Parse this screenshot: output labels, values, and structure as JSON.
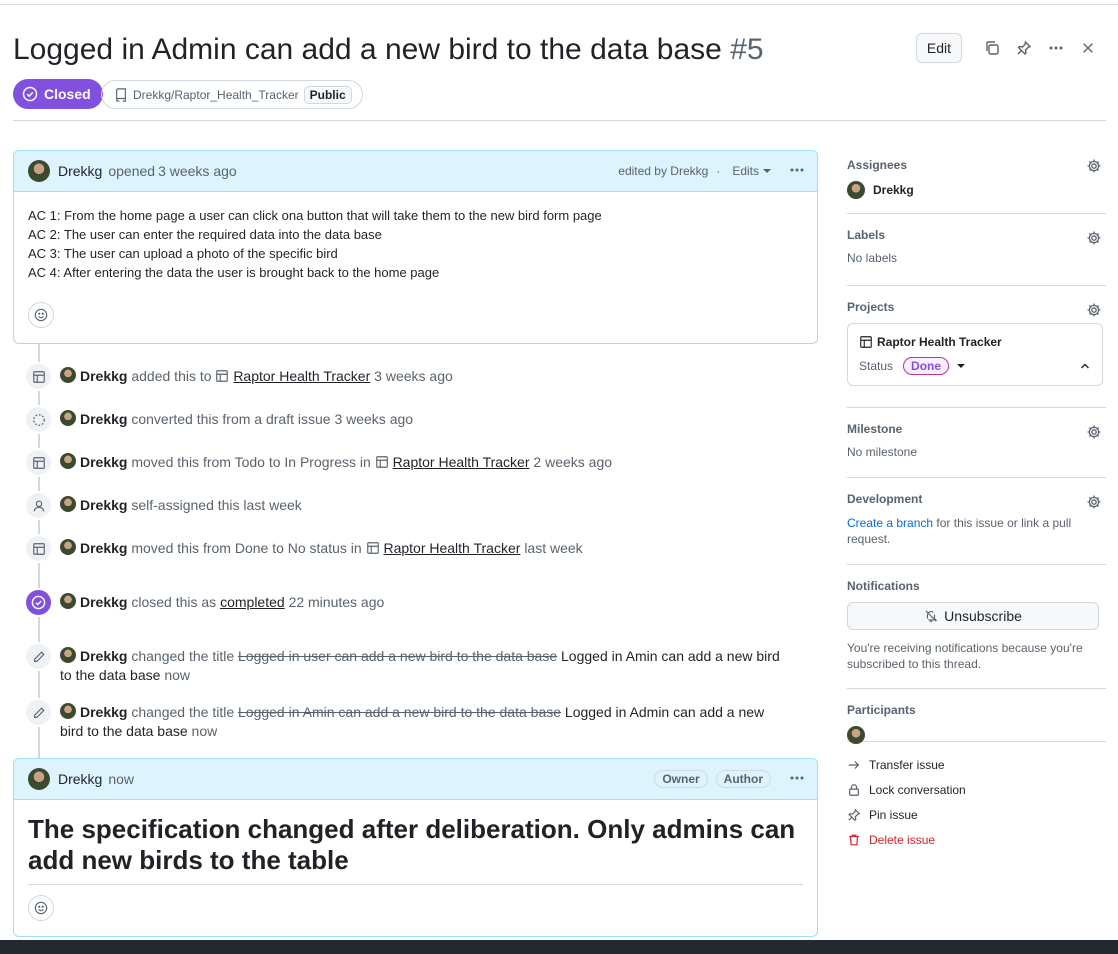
{
  "issue": {
    "title": "Logged in Admin can add a new bird to the data base",
    "number": "#5",
    "state": "Closed",
    "repo": "Drekkg/Raptor_Health_Tracker",
    "visibility": "Public",
    "edit_label": "Edit"
  },
  "opening_comment": {
    "author": "Drekkg",
    "action": "opened",
    "time": "3 weeks ago",
    "edited_by": "edited by Drekkg",
    "separator": "·",
    "edits_label": "Edits",
    "lines": [
      "AC 1: From the home page a user can click ona button that will take them to the new bird form page",
      "AC 2: The user can enter the required data into the data base",
      "AC 3: The user can upload a photo of the specific bird",
      "AC 4: After entering the data the user is brought back to the home page"
    ]
  },
  "timeline": [
    {
      "actor": "Drekkg",
      "text": "added this to",
      "link": "Raptor Health Tracker",
      "time": "3 weeks ago",
      "icon": "table-icon"
    },
    {
      "actor": "Drekkg",
      "text": "converted this from a draft issue",
      "time": "3 weeks ago",
      "icon": "draft-icon"
    },
    {
      "actor": "Drekkg",
      "text": "moved this from Todo to In Progress in",
      "link": "Raptor Health Tracker",
      "time": "2 weeks ago",
      "icon": "table-icon"
    },
    {
      "actor": "Drekkg",
      "text": "self-assigned this",
      "time": "last week",
      "icon": "person-icon"
    },
    {
      "actor": "Drekkg",
      "text": "moved this from Done to No status in",
      "link": "Raptor Health Tracker",
      "time": "last week",
      "icon": "table-icon"
    },
    {
      "actor": "Drekkg",
      "text": "closed this as",
      "link": "completed",
      "time": "22 minutes ago",
      "icon": "closed-icon"
    },
    {
      "actor": "Drekkg",
      "text": "changed the title",
      "old": "Logged in user can add a new bird to the data base",
      "new": "Logged in Amin can add a new bird to the data base",
      "time": "now",
      "icon": "pencil-icon"
    },
    {
      "actor": "Drekkg",
      "text": "changed the title",
      "old": "Logged in Amin can add a new bird to the data base",
      "new": "Logged in Admin can add a new bird to the data base",
      "time": "now",
      "icon": "pencil-icon"
    }
  ],
  "last_comment": {
    "author": "Drekkg",
    "time": "now",
    "owner_tag": "Owner",
    "author_tag": "Author",
    "heading": "The specification changed after deliberation. Only admins can add new birds to the table"
  },
  "sidebar": {
    "assignees_label": "Assignees",
    "assignee": "Drekkg",
    "labels_label": "Labels",
    "labels_value": "No labels",
    "projects_label": "Projects",
    "project_name": "Raptor Health Tracker",
    "status_label": "Status",
    "status_value": "Done",
    "milestone_label": "Milestone",
    "milestone_value": "No milestone",
    "development_label": "Development",
    "dev_link": "Create a branch",
    "dev_text": "for this issue or link a pull request.",
    "notifications_label": "Notifications",
    "unsubscribe_label": "Unsubscribe",
    "notif_text": "You're receiving notifications because you're subscribed to this thread.",
    "participants_label": "Participants",
    "transfer_label": "Transfer issue",
    "lock_label": "Lock conversation",
    "pin_label": "Pin issue",
    "delete_label": "Delete issue"
  },
  "colors": {
    "closed_purple": "#8250df",
    "link_blue": "#0969da",
    "danger_red": "#d1242f",
    "comment_header": "#ddf4ff"
  }
}
